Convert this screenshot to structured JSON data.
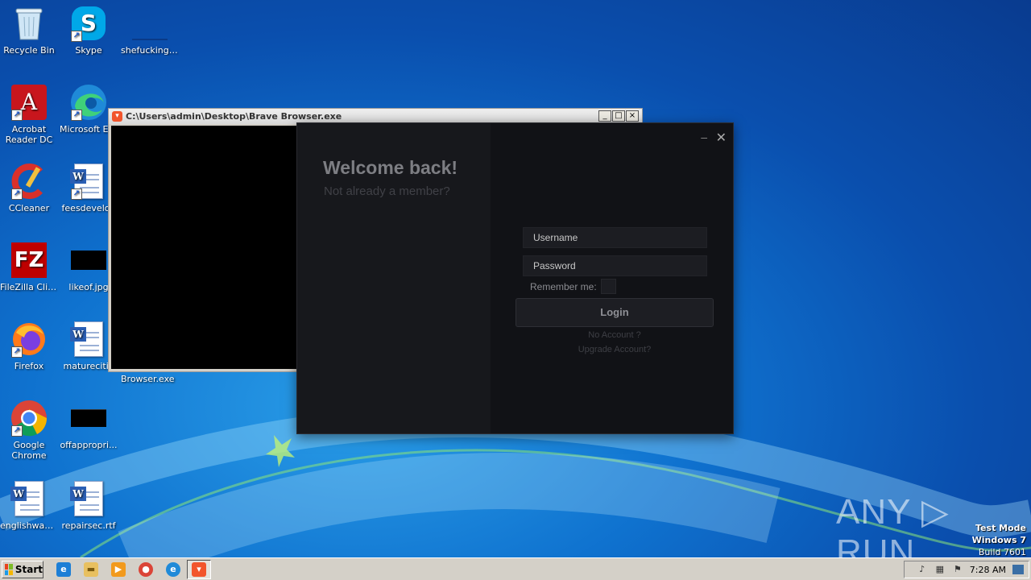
{
  "desktop": {
    "icons": [
      {
        "label": "Recycle Bin"
      },
      {
        "label": "Skype"
      },
      {
        "label": "shefucking...."
      },
      {
        "label": "Acrobat Reader DC"
      },
      {
        "label": "Microsoft Edge"
      },
      {
        "label": "CCleaner"
      },
      {
        "label": "feesdevelop"
      },
      {
        "label": "FileZilla Client"
      },
      {
        "label": "likeof.jpg"
      },
      {
        "label": "Firefox"
      },
      {
        "label": "maturecitie"
      },
      {
        "label": "Google Chrome"
      },
      {
        "label": "offappropri..."
      },
      {
        "label": "englishwas.rtf"
      },
      {
        "label": "repairsec.rtf"
      }
    ],
    "exe_label": "Browser.exe"
  },
  "console_window": {
    "title": "C:\\Users\\admin\\Desktop\\Brave Browser.exe",
    "min": "_",
    "max": "□",
    "close": "×"
  },
  "login_dialog": {
    "minimize": "–",
    "close": "✕",
    "welcome": "Welcome back!",
    "subtitle": "Not already a member?",
    "username_placeholder": "Username",
    "password_placeholder": "Password",
    "remember_label": "Remember me:",
    "login_label": "Login",
    "no_account": "No Account ?",
    "upgrade_account": "Upgrade Account?"
  },
  "watermark": {
    "text": "ANY ▷ RUN",
    "test_mode": "Test Mode",
    "os": "Windows 7",
    "build": "Build 7601"
  },
  "taskbar": {
    "start_label": "Start",
    "clock": "7:28 AM"
  }
}
